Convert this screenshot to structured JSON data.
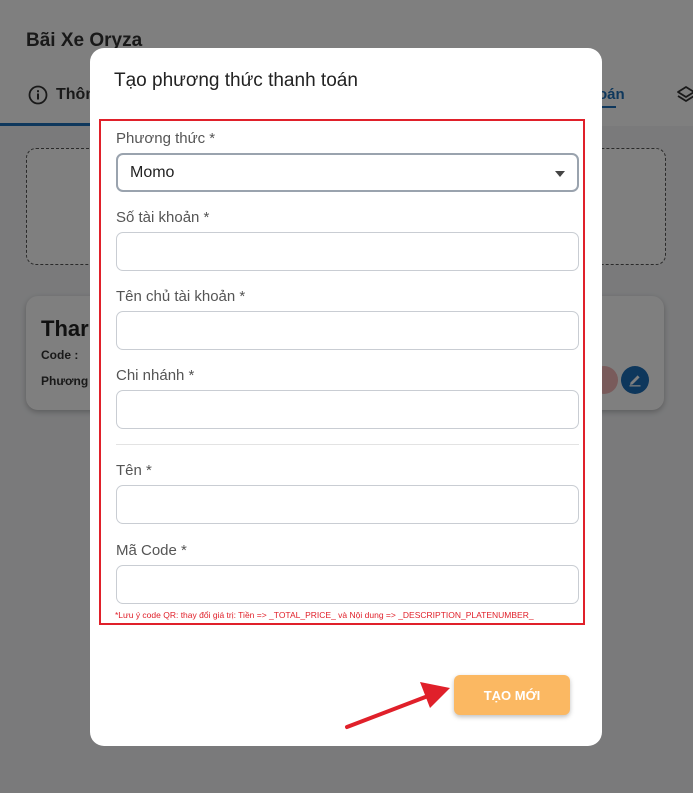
{
  "background": {
    "app_title": "Bãi Xe Oryza",
    "tab_left": "Thôn",
    "tab_right": "oán",
    "card_title": "Thar",
    "card_code_label": "Code :",
    "card_method_label": "Phương"
  },
  "modal": {
    "title": "Tạo phương thức thanh toán",
    "fields": [
      {
        "label": "Phương thức *",
        "value": "Momo"
      },
      {
        "label": "Số tài khoản *",
        "value": ""
      },
      {
        "label": "Tên chủ tài khoản *",
        "value": ""
      },
      {
        "label": "Chi nhánh *",
        "value": ""
      },
      {
        "label": "Tên *",
        "value": ""
      },
      {
        "label": "Mã Code *",
        "value": ""
      }
    ],
    "note": "*Lưu ý code QR: thay đổi giá trị: Tiền => _TOTAL_PRICE_ và Nội dung => _DESCRIPTION_PLATENUMBER_",
    "create_button": "TẠO MỚI"
  },
  "colors": {
    "accent": "#1d6fb8",
    "highlight_border": "#e0202a",
    "button": "#fbb862"
  }
}
